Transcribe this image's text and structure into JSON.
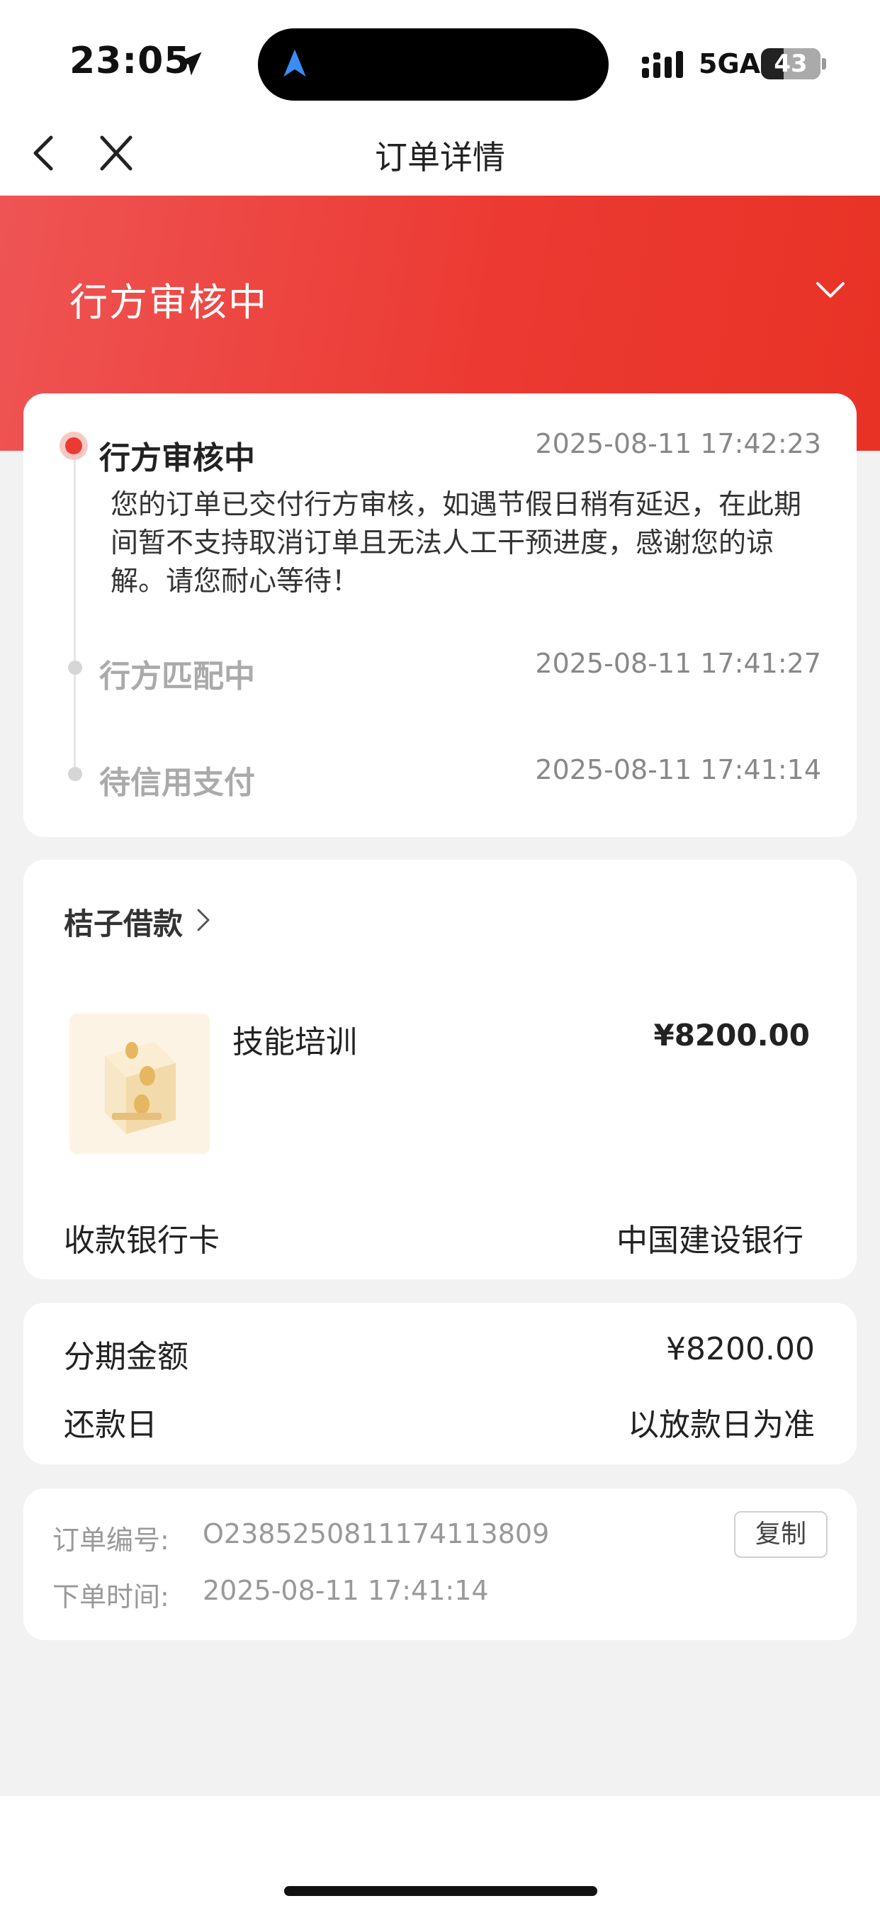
{
  "status_bar": {
    "time": "23:05",
    "network": "5GA",
    "battery": "43"
  },
  "nav": {
    "title": "订单详情"
  },
  "banner": {
    "status": "行方审核中"
  },
  "timeline": [
    {
      "title": "行方审核中",
      "time": "2025-08-11 17:42:23",
      "active": true,
      "description": "您的订单已交付行方审核，如遇节假日稍有延迟，在此期间暂不支持取消订单且无法人工干预进度，感谢您的谅解。请您耐心等待！"
    },
    {
      "title": "行方匹配中",
      "time": "2025-08-11 17:41:27",
      "active": false
    },
    {
      "title": "待信用支付",
      "time": "2025-08-11 17:41:14",
      "active": false
    }
  ],
  "order": {
    "merchant": "桔子借款",
    "product_name": "技能培训",
    "product_price": "¥8200.00",
    "bank_label": "收款银行卡",
    "bank_value": "中国建设银行"
  },
  "installment": {
    "amount_label": "分期金额",
    "amount_value": "¥8200.00",
    "repay_label": "还款日",
    "repay_value": "以放款日为准"
  },
  "meta": {
    "order_no_label": "订单编号:",
    "order_no_value": "O2385250811174113809",
    "copy_label": "复制",
    "order_time_label": "下单时间:",
    "order_time_value": "2025-08-11 17:41:14"
  },
  "colors": {
    "accent": "#ec3a32",
    "background": "#f2f2f2"
  }
}
